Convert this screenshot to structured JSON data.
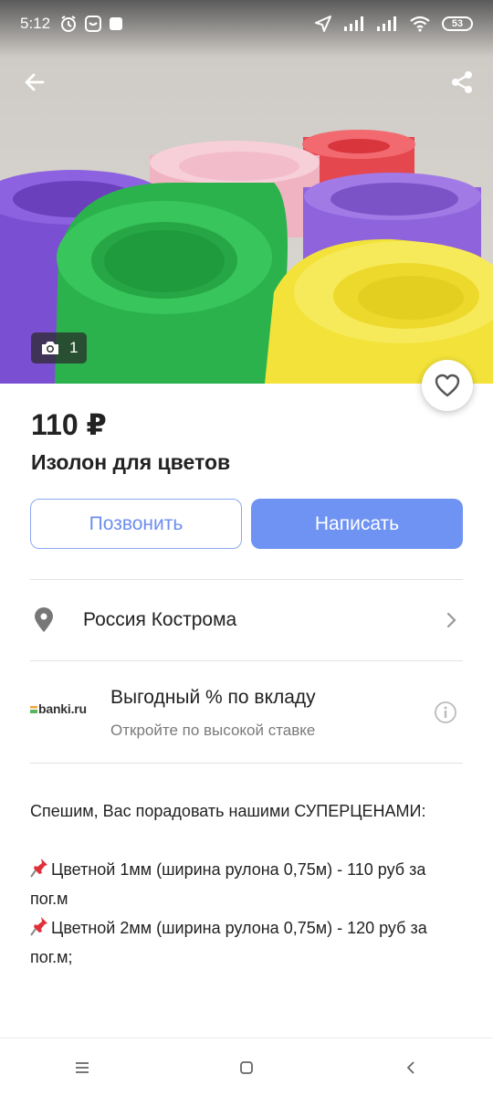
{
  "status_bar": {
    "time": "5:12",
    "battery": "53"
  },
  "gallery": {
    "photo_count": "1"
  },
  "listing": {
    "price": "110 ₽",
    "title": "Изолон для цветов"
  },
  "actions": {
    "call_label": "Позвонить",
    "write_label": "Написать"
  },
  "location": {
    "text": "Россия Кострома"
  },
  "ad": {
    "logo_text": "banki.ru",
    "title": "Выгодный % по вкладу",
    "subtitle": "Откройте по высокой ставке"
  },
  "description": {
    "line1": "Спешим, Вас порадовать нашими СУПЕРЦЕНАМИ:",
    "line2": "Цветной 1мм (ширина рулона 0,75м) - 110 руб за пог.м",
    "line3": "Цветной 2мм (ширина рулона 0,75м) - 120 руб за пог.м;"
  },
  "colors": {
    "accent": "#6f93f3",
    "accent_outline": "#8aa8f0"
  },
  "icons": [
    "back-arrow-icon",
    "share-icon",
    "camera-icon",
    "heart-icon",
    "location-pin-icon",
    "chevron-right-icon",
    "info-icon",
    "pushpin-icon",
    "menu-icon",
    "home-icon",
    "back-icon"
  ]
}
